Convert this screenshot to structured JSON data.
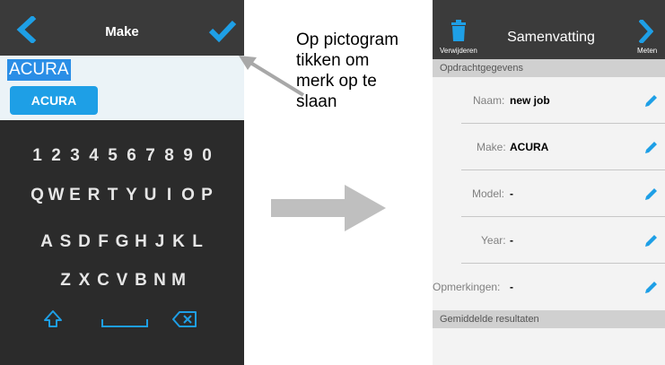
{
  "left_screen": {
    "header": {
      "title": "Make",
      "back_icon": "chevron-left-icon",
      "confirm_icon": "checkmark-icon"
    },
    "input": {
      "value": "ACURA"
    },
    "suggestion": {
      "label": "ACURA"
    },
    "keyboard": {
      "row1": [
        "1",
        "2",
        "3",
        "4",
        "5",
        "6",
        "7",
        "8",
        "9",
        "0"
      ],
      "row2": [
        "Q",
        "W",
        "E",
        "R",
        "T",
        "Y",
        "U",
        "I",
        "O",
        "P"
      ],
      "row3": [
        "A",
        "S",
        "D",
        "F",
        "G",
        "H",
        "J",
        "K",
        "L"
      ],
      "row4": [
        "Z",
        "X",
        "C",
        "V",
        "B",
        "N",
        "M"
      ],
      "shift_icon": "shift-arrow-icon",
      "space_icon": "space-bar-icon",
      "backspace_icon": "backspace-icon"
    }
  },
  "callout": {
    "text": "Op pictogram\ntikken om\nmerk op te\nslaan"
  },
  "right_screen": {
    "header": {
      "title": "Samenvatting",
      "delete_label": "Verwijderen",
      "measure_label": "Meten",
      "delete_icon": "trash-icon",
      "forward_icon": "chevron-right-icon"
    },
    "section_order": "Opdrachtgegevens",
    "fields": [
      {
        "label": "Naam:",
        "value": "new job"
      },
      {
        "label": "Make:",
        "value": "ACURA"
      },
      {
        "label": "Model:",
        "value": "-"
      },
      {
        "label": "Year:",
        "value": "-"
      },
      {
        "label": "Opmerkingen:",
        "value": "-"
      }
    ],
    "section_results": "Gemiddelde resultaten"
  },
  "colors": {
    "accent_blue": "#1e9fe6",
    "header_dark": "#3a3a3a",
    "keyboard_bg": "#2b2b2b",
    "arrow_gray": "#bfbfbf"
  }
}
